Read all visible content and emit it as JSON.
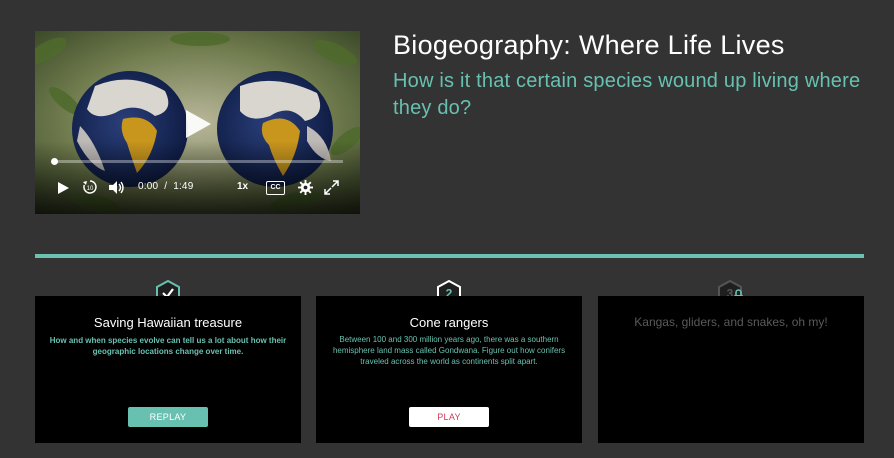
{
  "video": {
    "time_current": "0:00",
    "time_separator": "/",
    "time_total": "1:49",
    "speed_label": "1x",
    "cc_label": "CC",
    "skip_back_label": "10",
    "progress": 0.0,
    "icons": [
      "play-icon",
      "replay-10-icon",
      "volume-icon",
      "captions-icon",
      "settings-gear-icon",
      "fullscreen-icon"
    ]
  },
  "header": {
    "title": "Biogeography: Where Life Lives",
    "subtitle": "How is it that certain species wound up living where they do?"
  },
  "cards": [
    {
      "step": "1",
      "status": "completed",
      "title": "Saving Hawaiian treasure",
      "description": "How and when species evolve can tell us a lot about how their geographic locations change over time.",
      "button": "REPLAY"
    },
    {
      "step": "2",
      "status": "current",
      "title": "Cone rangers",
      "description": "Between 100 and 300 million years ago, there was a southern hemisphere land mass called Gondwana. Figure out how conifers traveled across the world as continents split apart.",
      "button": "PLAY"
    },
    {
      "step": "3",
      "status": "locked",
      "title": "Kangas, gliders, and snakes, oh my!"
    }
  ],
  "colors": {
    "background": "#333333",
    "accent": "#68c1b0",
    "play_text": "#d5385a",
    "card_bg": "#000000"
  }
}
